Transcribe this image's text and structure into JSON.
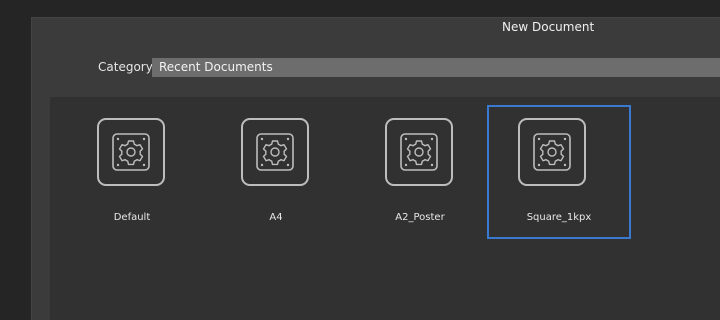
{
  "window": {
    "title": "New Document"
  },
  "category": {
    "label": "Category",
    "selected": "Recent Documents"
  },
  "documents": [
    {
      "label": "Default",
      "icon": "gear-icon",
      "selected": false
    },
    {
      "label": "A4",
      "icon": "gear-icon",
      "selected": false
    },
    {
      "label": "A2_Poster",
      "icon": "gear-icon",
      "selected": false
    },
    {
      "label": "Square_1kpx",
      "icon": "gear-icon",
      "selected": true
    }
  ],
  "colors": {
    "selection": "#3b78cf",
    "dialog_bg": "#3b3b3b",
    "grid_bg": "#313131",
    "select_bg": "#6d6d6d"
  }
}
